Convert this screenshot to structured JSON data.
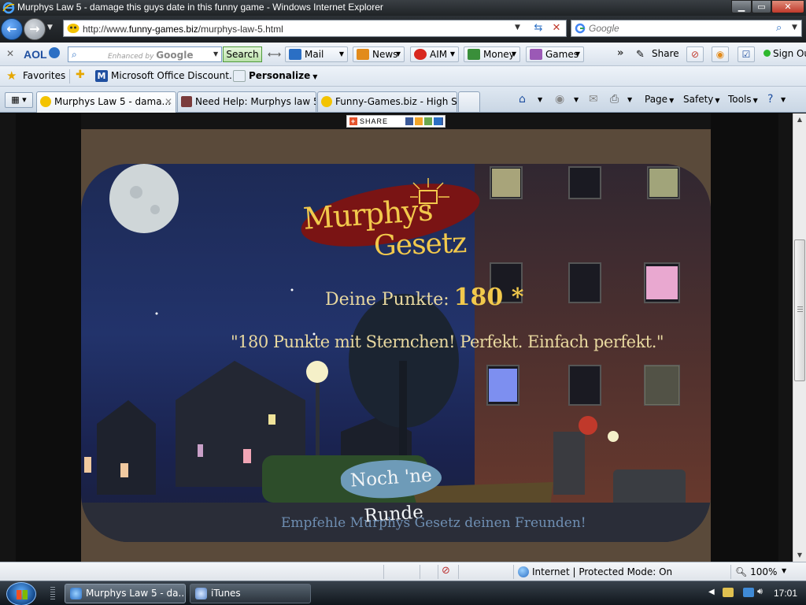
{
  "window": {
    "title": "Murphys Law 5 - damage this guys date in this funny game - Windows Internet Explorer",
    "min_label": "▁",
    "max_label": "▭",
    "close_label": "✕"
  },
  "address": {
    "url_prefix": "http://www.",
    "url_domain": "funny-games.biz",
    "url_path": "/murphys-law-5.html",
    "search_placeholder": "Google"
  },
  "aol_toolbar": {
    "brand": "AOL",
    "search_hint_prefix": "Enhanced by",
    "search_hint_brand": "Google",
    "search_button": "Search",
    "items": [
      {
        "label": "Mail",
        "icon": "mail-icon"
      },
      {
        "label": "News",
        "icon": "news-icon"
      },
      {
        "label": "AIM",
        "icon": "aim-icon"
      },
      {
        "label": "Money",
        "icon": "money-icon"
      },
      {
        "label": "Games",
        "icon": "games-icon"
      }
    ],
    "share_label": "Share",
    "signout_label": "Sign Out"
  },
  "favorites_bar": {
    "favorites_label": "Favorites",
    "links": [
      {
        "label": "Microsoft Office Discount..."
      },
      {
        "label": "Personalize"
      }
    ]
  },
  "tabs": [
    {
      "label": "Murphys Law 5 - dama...",
      "active": true
    },
    {
      "label": "Need Help: Murphys law 5...",
      "active": false
    },
    {
      "label": "Funny-Games.biz - High S...",
      "active": false
    }
  ],
  "command_bar": {
    "page_label": "Page",
    "safety_label": "Safety",
    "tools_label": "Tools"
  },
  "page": {
    "share_button": "SHARE",
    "game": {
      "logo_line1": "Murphys",
      "logo_line2": "Gesetz",
      "score_label": "Deine Punkte:",
      "score_value": "180 *",
      "quote": "\"180 Punkte mit Sternchen! Perfekt. Einfach perfekt.\"",
      "play_again": "Noch 'ne Runde",
      "recommend": "Empfehle Murphys Gesetz deinen Freunden!"
    }
  },
  "status_bar": {
    "zone": "Internet | Protected Mode: On",
    "zoom": "100%"
  },
  "taskbar": {
    "buttons": [
      {
        "label": "Murphys Law 5 - da...",
        "active": true
      },
      {
        "label": "iTunes",
        "active": false
      }
    ],
    "clock": "17:01"
  },
  "colors": {
    "sky": "#1d2a55",
    "logo_red": "#7a1414",
    "logo_yellow": "#f2c94c",
    "text_cream": "#e9d9a0",
    "button_blue": "#6e9bb8"
  }
}
